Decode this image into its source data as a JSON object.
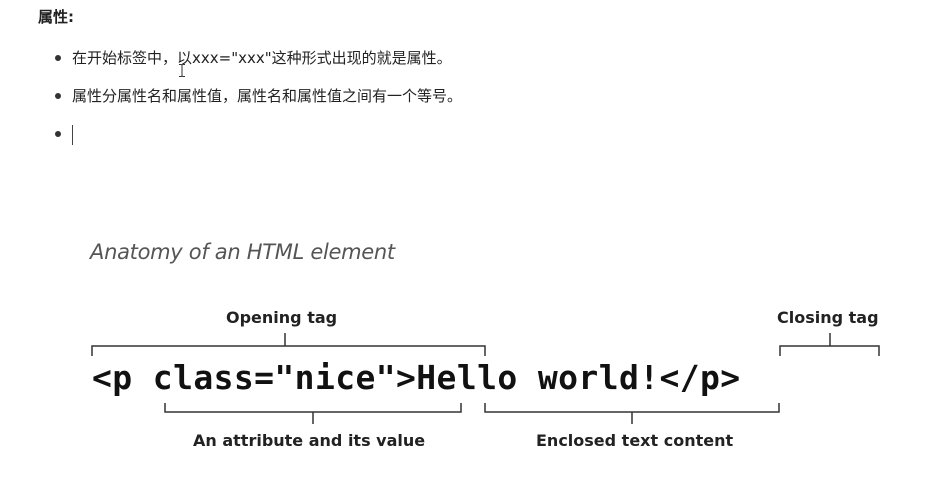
{
  "section": {
    "heading": "属性:"
  },
  "bullets": [
    {
      "text": "在开始标签中，以xxx=\"xxx\"这种形式出现的就是属性。"
    },
    {
      "text": "属性分属性名和属性值，属性名和属性值之间有一个等号。"
    },
    {
      "text": ""
    }
  ],
  "diagram": {
    "title": "Anatomy of an HTML element",
    "code": "<p class=\"nice\">Hello world!</p>",
    "labels": {
      "opening_tag": "Opening tag",
      "closing_tag": "Closing tag",
      "attribute": "An attribute and its value",
      "content": "Enclosed text content"
    }
  }
}
